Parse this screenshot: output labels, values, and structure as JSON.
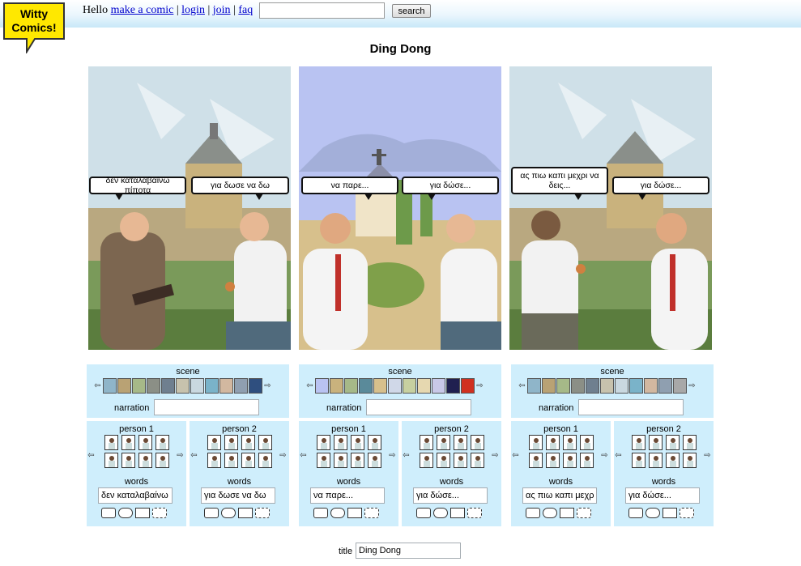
{
  "header": {
    "logo_line1": "Witty",
    "logo_line2": "Comics!",
    "greeting": "Hello",
    "links": [
      "make a comic",
      "login",
      "join",
      "faq"
    ],
    "separator": "|",
    "search_value": "",
    "search_button": "search"
  },
  "comic": {
    "title": "Ding Dong",
    "panels": [
      {
        "bubble_left": "δεν καταλαβαίνω πίποτα",
        "bubble_right": "για δωσε να δω"
      },
      {
        "bubble_left": "να παρε...",
        "bubble_right": "για δώσε..."
      },
      {
        "bubble_left": "ας πιω καπι μεχρι να δεις...",
        "bubble_right": "για δώσε..."
      }
    ]
  },
  "controls": {
    "scene_label": "scene",
    "narration_label": "narration",
    "person1_label": "person 1",
    "person2_label": "person 2",
    "words_label": "words",
    "arrow_left": "⇦",
    "arrow_right": "⇨",
    "panels": [
      {
        "narration": "",
        "words1": "δεν καταλαβαίνω",
        "words2": "για δωσε να δω"
      },
      {
        "narration": "",
        "words1": "να παρε...",
        "words2": "για δώσε..."
      },
      {
        "narration": "",
        "words1": "ας πιω καπι μεχρι",
        "words2": "για δώσε..."
      }
    ]
  },
  "footer": {
    "title_label": "title",
    "title_value": "Ding Dong"
  },
  "colors": {
    "panel_bg": "#cfeefc",
    "link": "#0000cc",
    "logo_bg": "#ffe800"
  }
}
